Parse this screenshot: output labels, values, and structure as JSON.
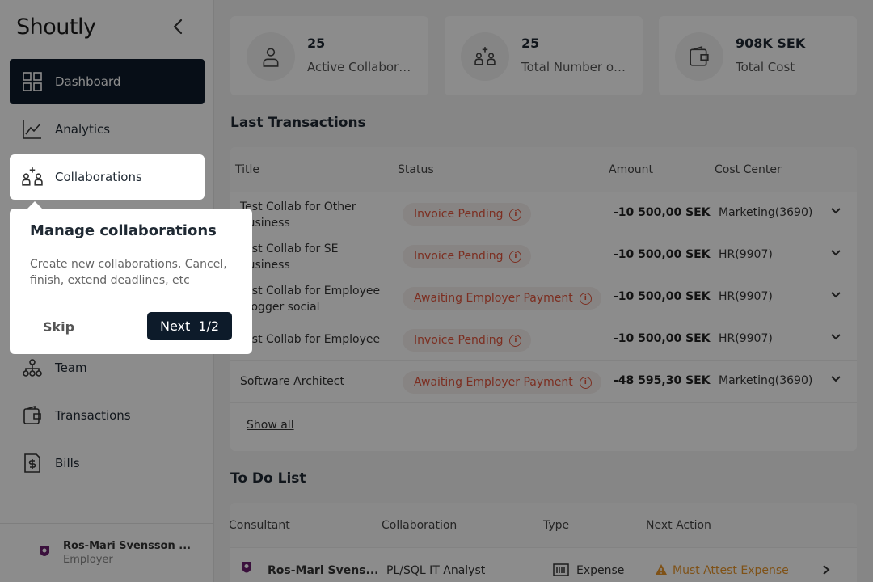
{
  "app": {
    "logo": "Shoutly"
  },
  "sidebar": {
    "items": [
      {
        "label": "Dashboard",
        "icon": "grid-icon"
      },
      {
        "label": "Analytics",
        "icon": "chart-line-icon"
      },
      {
        "label": "Collaborations",
        "icon": "people-plus-icon"
      },
      {
        "label": "Team",
        "icon": "org-chart-icon"
      },
      {
        "label": "Transactions",
        "icon": "wallet-icon"
      },
      {
        "label": "Bills",
        "icon": "bill-icon"
      }
    ],
    "user": {
      "name": "Ros-Mari Svensson ...",
      "role": "Employer"
    }
  },
  "stats": [
    {
      "value": "25",
      "label": "Active Collaborations"
    },
    {
      "value": "25",
      "label": "Total Number of Collaborations"
    },
    {
      "value": "908K SEK",
      "label": "Total Cost"
    }
  ],
  "transactions": {
    "title": "Last Transactions",
    "columns": [
      "Title",
      "Status",
      "Amount",
      "Cost Center"
    ],
    "rows": [
      {
        "title": "Test Collab for Other Business",
        "status": "Invoice Pending",
        "amount": "-10 500,00 SEK",
        "cost_center": "Marketing(3690)"
      },
      {
        "title": "Test Collab for SE Business",
        "status": "Invoice Pending",
        "amount": "-10 500,00 SEK",
        "cost_center": "HR(9907)"
      },
      {
        "title": "Test Collab for Employee Blogger social",
        "status": "Awaiting Employer Payment",
        "amount": "-10 500,00 SEK",
        "cost_center": "HR(9907)"
      },
      {
        "title": "Test Collab for Employee",
        "status": "Invoice Pending",
        "amount": "-10 500,00 SEK",
        "cost_center": "HR(9907)"
      },
      {
        "title": "Software Architect",
        "status": "Awaiting Employer Payment",
        "amount": "-48 595,30 SEK",
        "cost_center": "Marketing(3690)"
      }
    ],
    "show_all": "Show all"
  },
  "todo": {
    "title": "To Do List",
    "columns": [
      "Consultant",
      "Collaboration",
      "Type",
      "Next Action"
    ],
    "rows": [
      {
        "consultant": "Ros-Mari Svens...",
        "collaboration": "PL/SQL IT Analyst",
        "type": "Expense",
        "next_action": "Must Attest Expense"
      }
    ]
  },
  "tour": {
    "title": "Manage collaborations",
    "body": "Create new collaborations, Cancel, finish, extend deadlines, etc",
    "skip": "Skip",
    "next": "Next",
    "step": "1/2"
  },
  "colors": {
    "primary": "#0d1b2a",
    "status": "#e2553c",
    "warning": "#e8952a"
  }
}
